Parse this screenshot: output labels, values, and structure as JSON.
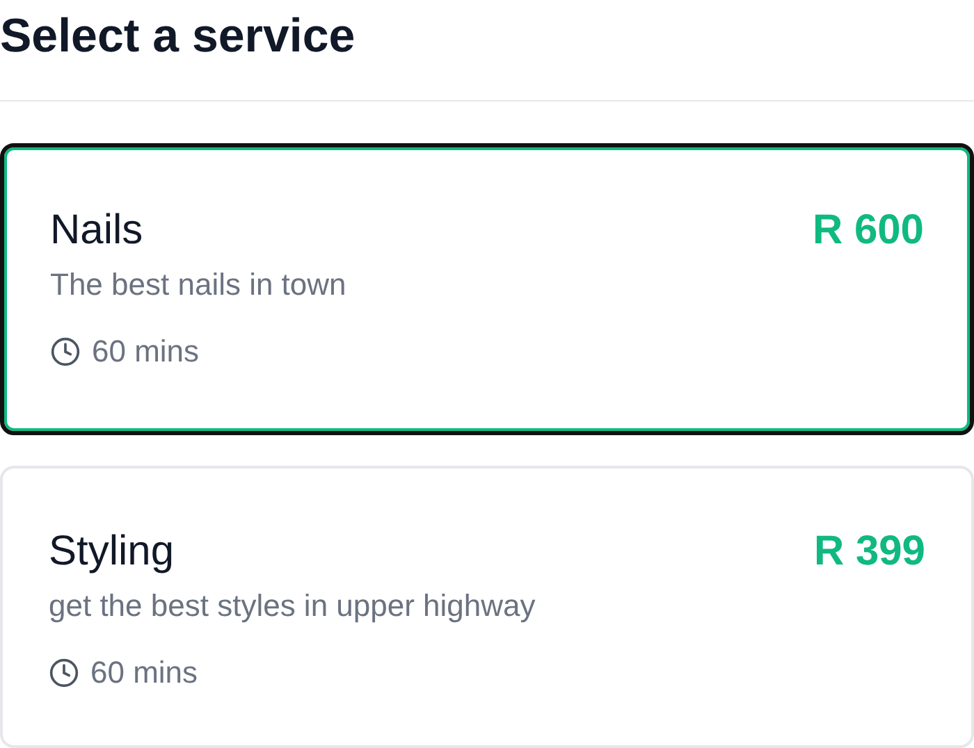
{
  "title": "Select a service",
  "services": [
    {
      "name": "Nails",
      "price": "R 600",
      "description": "The best nails in town",
      "duration": "60 mins",
      "selected": true
    },
    {
      "name": "Styling",
      "price": "R 399",
      "description": "get the best styles in upper highway",
      "duration": "60 mins",
      "selected": false
    }
  ]
}
